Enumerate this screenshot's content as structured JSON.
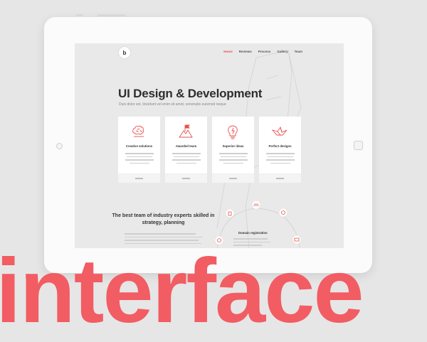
{
  "brand": {
    "logo_letter": "b"
  },
  "nav": {
    "items": [
      "Home",
      "Reviews",
      "Process",
      "Gallery",
      "Team"
    ],
    "active": "Home"
  },
  "hero": {
    "title": "UI Design & Development",
    "subtitle": "Duis dolor est, tincidunt vel enim sit amet, venenatis euismod neque"
  },
  "cards": [
    {
      "title": "Creative solutions",
      "icon": "brain-icon"
    },
    {
      "title": "Awarded team",
      "icon": "flag-mountain-icon"
    },
    {
      "title": "Superior ideas",
      "icon": "lightbulb-icon"
    },
    {
      "title": "Perfect designs",
      "icon": "origami-bird-icon"
    }
  ],
  "team": {
    "title": "The best team of industry experts skilled in strategy, planning"
  },
  "process": {
    "active_step": "Domain registration"
  },
  "overlay_word": "interface",
  "colors": {
    "accent": "#e8504f",
    "overlay": "#f25c63",
    "background": "#e6e6e6"
  }
}
